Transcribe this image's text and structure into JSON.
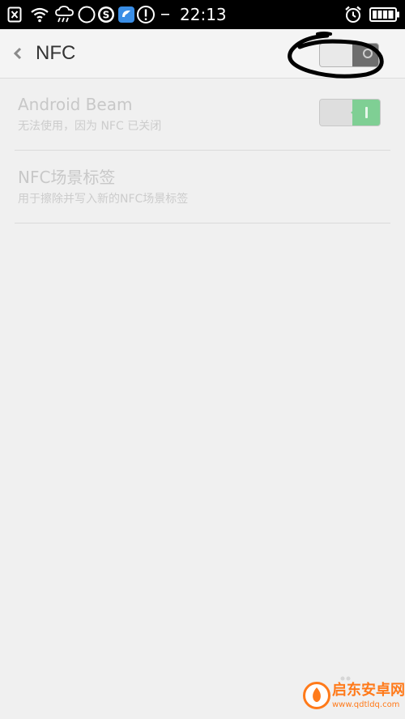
{
  "status_bar": {
    "time": "22:13",
    "icons": [
      "close-box-icon",
      "wifi-icon",
      "weather-rain-icon",
      "moon-icon",
      "sogou-icon",
      "app-icon",
      "alert-icon",
      "more-dots-icon",
      "alarm-icon",
      "battery-icon"
    ]
  },
  "header": {
    "title": "NFC",
    "back_icon": "chevron-left-icon",
    "nfc_toggle_state": "off"
  },
  "settings": {
    "android_beam": {
      "title": "Android Beam",
      "subtitle": "无法使用，因为 NFC 已关闭",
      "toggle_state": "on-disabled"
    },
    "nfc_tags": {
      "title": "NFC场景标签",
      "subtitle": "用于擦除并写入新的NFC场景标签"
    }
  },
  "watermark": {
    "name": "启东安卓网",
    "url": "www.qdtldq.com"
  },
  "colors": {
    "status_bar": "#000000",
    "background": "#f0f0f0",
    "toggle_on": "#7fcf94",
    "annotation": "#000000",
    "watermark": "#ff7a1a"
  }
}
